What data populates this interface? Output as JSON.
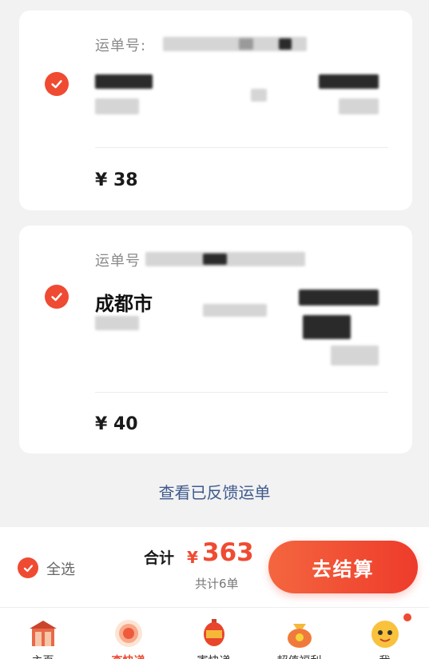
{
  "orders": [
    {
      "waybill_label": "运单号:",
      "city": "",
      "price": "¥ 38"
    },
    {
      "waybill_label": "运单号",
      "city": "成都市",
      "price": "¥ 40"
    }
  ],
  "feedback_link": "查看已反馈运单",
  "checkout": {
    "select_all_label": "全选",
    "total_label": "合计",
    "currency": "¥",
    "total_value": "363",
    "count_text": "共计6单",
    "button_label": "去结算"
  },
  "tabs": [
    {
      "label": "主页",
      "icon": "home-gate-icon"
    },
    {
      "label": "查快递",
      "icon": "search-package-icon",
      "active": true
    },
    {
      "label": "寄快递",
      "icon": "lantern-package-icon"
    },
    {
      "label": "超值福利",
      "icon": "lucky-bag-icon"
    },
    {
      "label": "我",
      "icon": "mascot-avatar-icon"
    }
  ],
  "colors": {
    "accent": "#ef4b32",
    "link": "#3e5a8c",
    "background": "#f2f2f3"
  }
}
